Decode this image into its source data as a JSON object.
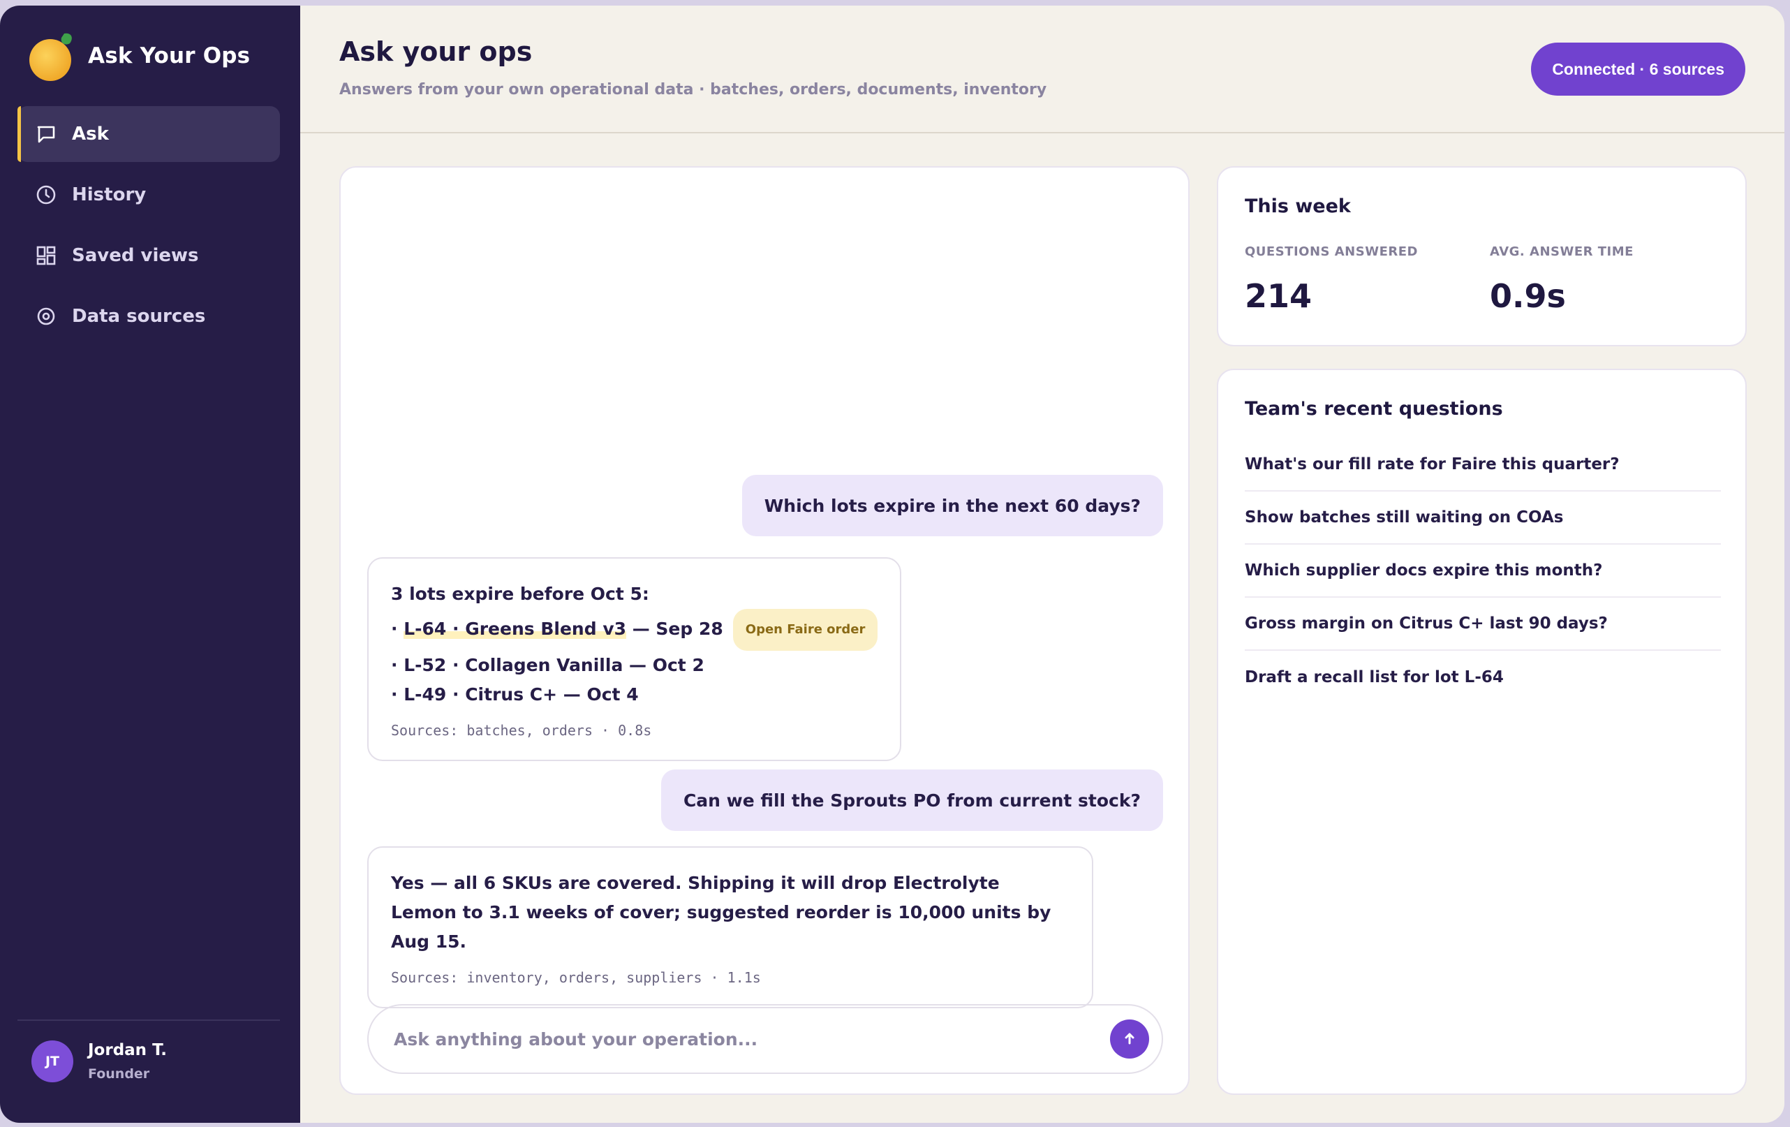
{
  "app": {
    "name": "Ask Your Ops"
  },
  "sidebar": {
    "items": [
      {
        "label": "Ask",
        "icon": "chat-icon",
        "active": true
      },
      {
        "label": "History",
        "icon": "clock-icon"
      },
      {
        "label": "Saved views",
        "icon": "grid-icon"
      },
      {
        "label": "Data sources",
        "icon": "target-icon"
      }
    ],
    "user": {
      "initials": "JT",
      "name": "Jordan T.",
      "role": "Founder"
    }
  },
  "header": {
    "title": "Ask your ops",
    "subtitle": "Answers from your own operational data · batches, orders, documents, inventory",
    "connection_label": "Connected · 6 sources"
  },
  "chat": {
    "q1": "Which lots expire in the next 60 days?",
    "a1": {
      "intro": "3 lots expire before Oct 5:",
      "l1_prefix": "· ",
      "l1_code": "L-64 · Greens Blend v3",
      "l1_suffix": " — Sep 28",
      "l1_tag": "Open Faire order",
      "l2": "· L-52 · Collagen Vanilla — Oct 2",
      "l3": "· L-49 · Citrus C+ — Oct 4",
      "sources": "Sources: batches, orders · 0.8s"
    },
    "q2": "Can we fill the Sprouts PO from current stock?",
    "a2": {
      "text_1": "Yes — all 6 SKUs are covered. Shipping it will drop Electrolyte Lemon to ",
      "bold": "3.1 weeks of cover",
      "text_2": "; suggested reorder is 10,000 units by Aug 15.",
      "sources": "Sources: inventory, orders, suppliers · 1.1s"
    },
    "composer_placeholder": "Ask anything about your operation..."
  },
  "stats": {
    "title": "This week",
    "questions_label": "QUESTIONS ANSWERED",
    "questions_value": "214",
    "avg_label": "AVG. ANSWER TIME",
    "avg_value": "0.9s"
  },
  "recent": {
    "title": "Team's recent questions",
    "items": [
      "What's our fill rate for Faire this quarter?",
      "Show batches still waiting on COAs",
      "Which supplier docs expire this month?",
      "Gross margin on Citrus C+ last 90 days?",
      "Draft a recall list for lot L-64"
    ]
  },
  "colors": {
    "sidebar": "#261d47",
    "accent": "#7142cf",
    "active_marker": "#f5c445"
  }
}
